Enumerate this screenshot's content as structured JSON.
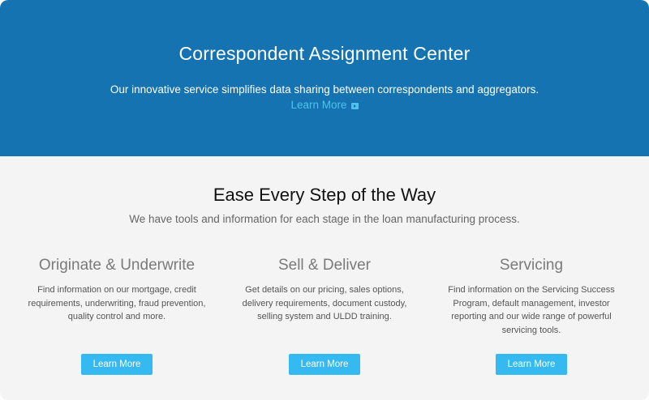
{
  "hero": {
    "title": "Correspondent Assignment Center",
    "description": "Our innovative service simplifies data sharing between correspondents and aggregators.",
    "link_label": "Learn More",
    "link_icon": "arrow-right-icon",
    "background_color": "#1473b0",
    "link_color": "#4fc3f0"
  },
  "section": {
    "title": "Ease Every Step of the Way",
    "subtitle": "We have tools and information for each stage in the loan manufacturing process."
  },
  "columns": [
    {
      "title": "Originate & Underwrite",
      "description": "Find information on our mortgage, credit requirements, underwriting, fraud prevention, quality control and more.",
      "button_label": "Learn More"
    },
    {
      "title": "Sell & Deliver",
      "description": "Get details on our pricing, sales options, delivery requirements, document custody, selling system and ULDD training.",
      "button_label": "Learn More"
    },
    {
      "title": "Servicing",
      "description": "Find information on the Servicing Success Program, default management, investor reporting and our wide range of powerful servicing tools.",
      "button_label": "Learn More"
    }
  ],
  "colors": {
    "button": "#35b9f1",
    "page_background": "#f4f4f4"
  }
}
